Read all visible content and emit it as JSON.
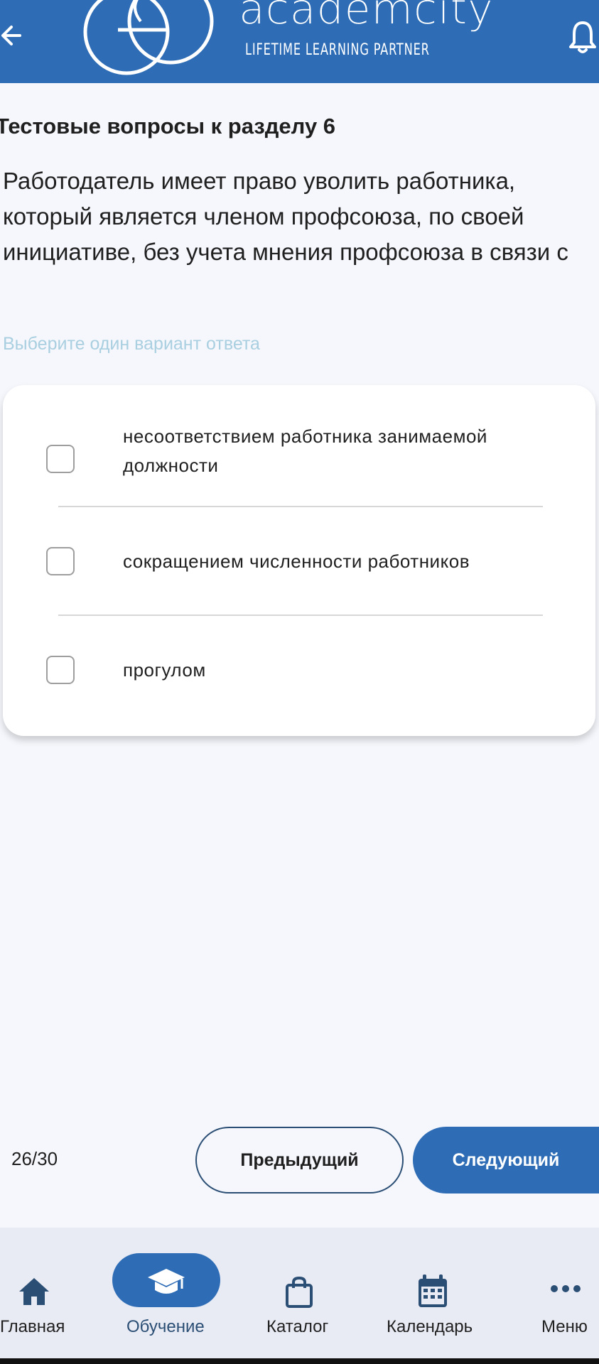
{
  "header": {
    "logo_word": "academcity",
    "logo_tagline": "LIFETIME LEARNING PARTNER",
    "back_icon": "arrow-left-icon",
    "bell_icon": "bell-icon"
  },
  "main": {
    "section_title": "Тестовые вопросы к разделу 6",
    "question": "Работодатель имеет право уволить работника, который является членом профсоюза, по своей инициативе, без учета мнения профсоюза в связи с",
    "hint": "Выберите один вариант ответа",
    "options": [
      {
        "label": "несоответствием работника занимаемой должности",
        "checked": false
      },
      {
        "label": "сокращением численности работников",
        "checked": false
      },
      {
        "label": "прогулом",
        "checked": false
      }
    ]
  },
  "pager": {
    "counter": "26/30",
    "prev_label": "Предыдущий",
    "next_label": "Следующий"
  },
  "bottom_nav": {
    "items": [
      {
        "label": "Главная",
        "icon": "home-icon",
        "active": false
      },
      {
        "label": "Обучение",
        "icon": "graduation-cap-icon",
        "active": true
      },
      {
        "label": "Каталог",
        "icon": "shopping-bag-icon",
        "active": false
      },
      {
        "label": "Календарь",
        "icon": "calendar-icon",
        "active": false
      },
      {
        "label": "Меню",
        "icon": "more-dots-icon",
        "active": false
      }
    ]
  },
  "colors": {
    "brand": "#2e6db6",
    "nav_icon": "#2b4e74",
    "active_label": "#2b4e74",
    "hint": "#a9cfe0",
    "background": "#f5f7fc"
  }
}
